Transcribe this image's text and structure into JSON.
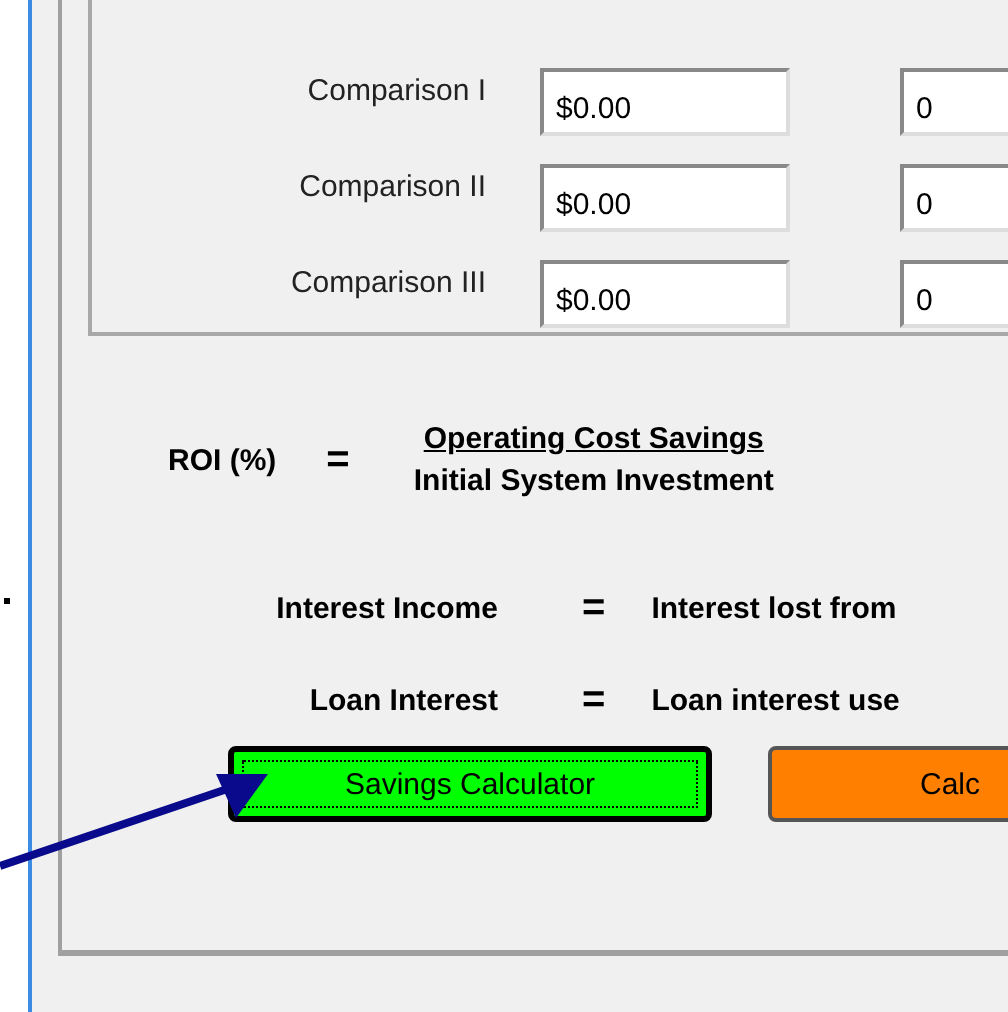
{
  "comparisons": [
    {
      "label": "Comparison I",
      "savings": "$0.00",
      "column_2": "0"
    },
    {
      "label": "Comparison II",
      "savings": "$0.00",
      "column_2": "0"
    },
    {
      "label": "Comparison III",
      "savings": "$0.00",
      "column_2": "0"
    }
  ],
  "roi": {
    "label": "ROI (%)",
    "equals": "=",
    "numerator": "Operating Cost Savings",
    "denominator": "Initial System Investment"
  },
  "definitions": [
    {
      "label": "Interest Income",
      "equals": "=",
      "text": "Interest lost from"
    },
    {
      "label": "Loan Interest",
      "equals": "=",
      "text": "Loan interest use"
    }
  ],
  "buttons": [
    {
      "label": "Savings Calculator",
      "color": "#00ff00",
      "focused": true
    },
    {
      "label": "Calc",
      "color": "#ff8000",
      "focused": false
    }
  ]
}
